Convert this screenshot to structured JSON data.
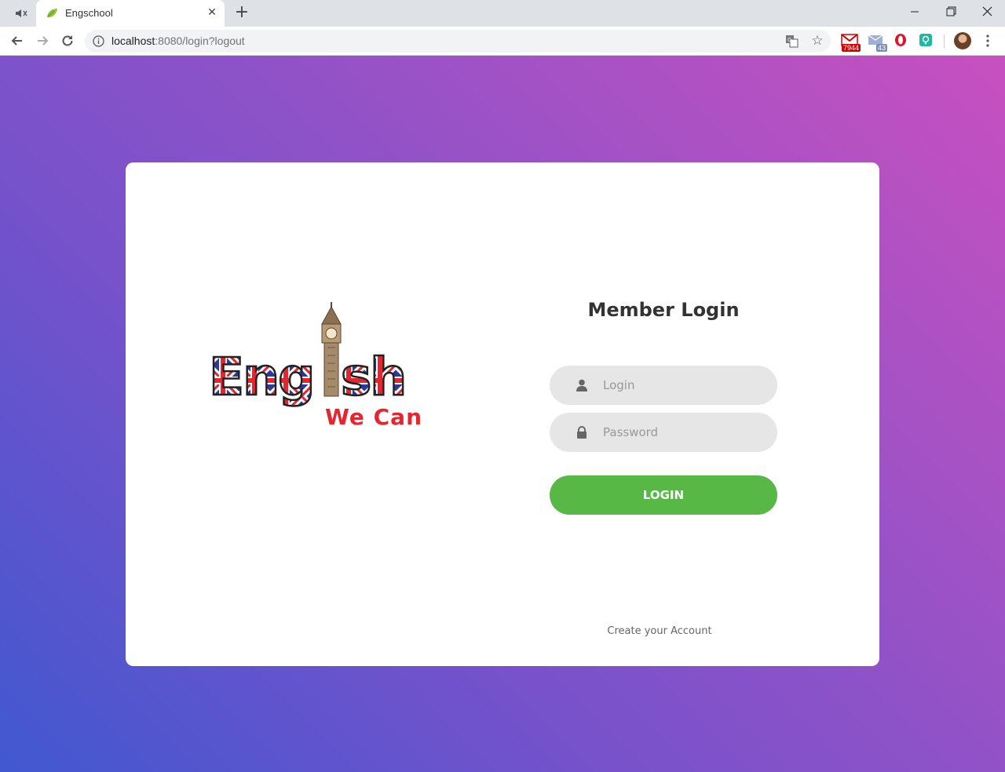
{
  "browser": {
    "tab": {
      "title": "Engschool"
    },
    "address": {
      "host": "localhost",
      "rest": ":8080/login?logout"
    },
    "extensions": {
      "gmail_count": "7944",
      "mail_count": "43"
    }
  },
  "logo": {
    "word": "English",
    "tagline": "We Can"
  },
  "login": {
    "title": "Member Login",
    "login_placeholder": "Login",
    "password_placeholder": "Password",
    "button_label": "LOGIN",
    "create_account": "Create your Account"
  },
  "colors": {
    "gradient_start": "#c850c0",
    "gradient_end": "#4158d0",
    "button": "#57b846",
    "field_bg": "#e6e6e6"
  }
}
